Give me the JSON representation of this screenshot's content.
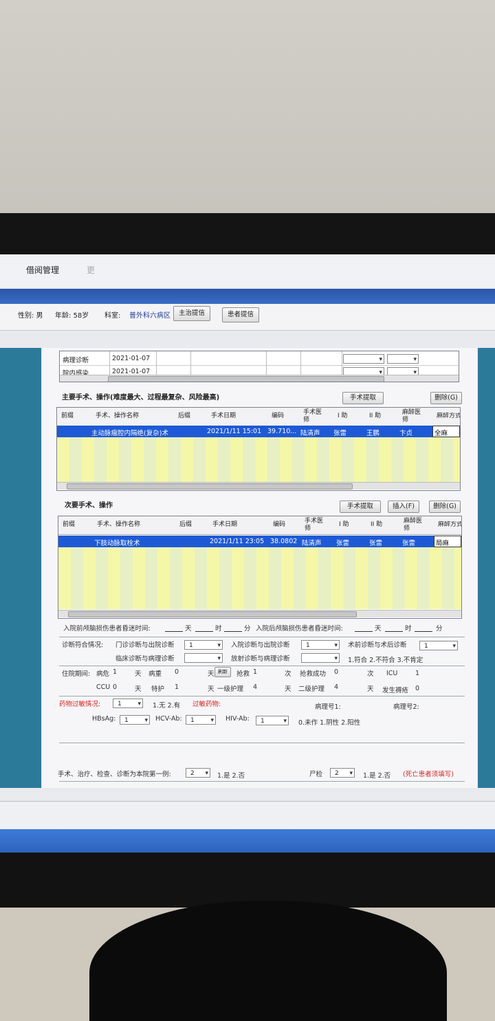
{
  "menu": {
    "item1": "借阅管理",
    "item2": "更"
  },
  "patient": {
    "gender": "性别: 男",
    "age": "年龄: 58岁",
    "dept_label": "科室:",
    "dept": "普外科六病区",
    "btn_doctor": "主治提信",
    "btn_patient": "患者提信"
  },
  "diag_rows": [
    {
      "label": "病理诊断",
      "date": "2021-01-07"
    },
    {
      "label": "院内感染",
      "date": "2021-01-07"
    }
  ],
  "main_surgery": {
    "title": "主要手术、操作(难度最大、过程最复杂、风险最高)",
    "btn_extract": "手术提取",
    "btn_delete": "删除(G)",
    "headers": [
      "前缀",
      "手术、操作名称",
      "后缀",
      "手术日期",
      "编码",
      "手术医师",
      "I 助",
      "II 助",
      "麻醉医师",
      "麻醉方式"
    ],
    "row": {
      "name": "主动脉瘤腔内隔绝(复杂)术",
      "date": "2021/1/11 15:01",
      "code": "39.710...",
      "surgeon": "陆清声",
      "assist1": "张雷",
      "assist2": "王鹏",
      "anesth": "卞贞",
      "method": "全麻"
    }
  },
  "sub_surgery": {
    "title": "次要手术、操作",
    "btn_extract": "手术提取",
    "btn_insert": "插入(F)",
    "btn_delete": "删除(G)",
    "headers": [
      "前缀",
      "手术、操作名称",
      "后缀",
      "手术日期",
      "编码",
      "手术医师",
      "I 助",
      "II 助",
      "麻醉医师",
      "麻醉方式"
    ],
    "row": {
      "name": "下肢动脉取栓术",
      "date": "2021/1/11 23:05",
      "code": "38.0802",
      "surgeon": "陆清声",
      "assist1": "张雷",
      "assist2": "张雷",
      "anesth": "张雷",
      "method": "局麻"
    }
  },
  "coma": {
    "before": "入院前颅脑损伤患者昏迷时间:",
    "after": "入院后颅脑损伤患者昏迷时间:",
    "day": "天",
    "hour": "时",
    "minute": "分"
  },
  "diag_match": {
    "label": "诊断符合情况:",
    "opt1_label": "门诊诊断与出院诊断",
    "opt1_val": "1",
    "opt2_label": "入院诊断与出院诊断",
    "opt2_val": "1",
    "opt3_label": "术前诊断与术后诊断",
    "opt3_val": "1",
    "opt4_label": "临床诊断与病理诊断",
    "opt5_label": "放射诊断与病理诊断",
    "legend": "1.符合 2.不符合 3.不肯定"
  },
  "stay": {
    "label": "住院期间:",
    "critical_label": "病危",
    "critical_val": "1",
    "severe_label": "病重",
    "severe_val": "0",
    "day": "天",
    "rescue_btn": "刷新",
    "rescue_label": "抢救",
    "rescue_val": "1",
    "times": "次",
    "rescue_ok_label": "抢救成功",
    "rescue_ok_val": "0",
    "icu_label": "ICU",
    "icu_val": "1",
    "ccu_label": "CCU",
    "ccu_val": "0",
    "special_label": "特护",
    "special_val": "1",
    "level1_label": "一级护理",
    "level1_val": "4",
    "level2_label": "二级护理",
    "level2_val": "4",
    "sore_label": "发生褥疮",
    "sore_val": "0"
  },
  "allergy": {
    "label": "药物过敏情况:",
    "val": "1",
    "legend": "1.无 2.有",
    "drug_label": "过敏药物:",
    "path1": "病理号1:",
    "path2": "病理号2:"
  },
  "virus": {
    "hbsag_label": "HBsAg:",
    "hbsag_val": "1",
    "hcv_label": "HCV-Ab:",
    "hcv_val": "1",
    "hiv_label": "HIV-Ab:",
    "hiv_val": "1",
    "legend": "0.未作  1.阴性  2.阳性"
  },
  "footer_row": {
    "first_label": "手术、治疗、检查、诊断为本院第一例:",
    "first_val": "2",
    "first_legend": "1.是 2.否",
    "autopsy_label": "尸检",
    "autopsy_val": "2",
    "autopsy_legend": "1.是 2.否",
    "autopsy_note": "(死亡患者须填写)"
  },
  "colors": {
    "selection": "#1e5ad6",
    "panel": "#2b7a9a",
    "band": "#2a55a8"
  }
}
